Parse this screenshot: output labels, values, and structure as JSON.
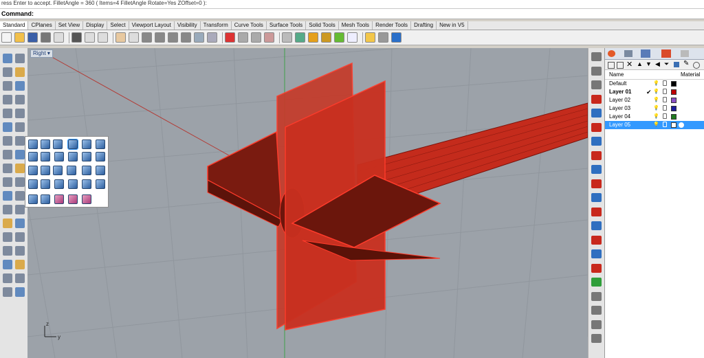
{
  "command": {
    "history": "ress Enter to accept. FilletAngle = 360 ( Items=4  FilletAngle  Rotate=Yes  ZOffset=0 ):",
    "prompt_label": "Command:",
    "value": ""
  },
  "tabs": [
    "Standard",
    "CPlanes",
    "Set View",
    "Display",
    "Select",
    "Viewport Layout",
    "Visibility",
    "Transform",
    "Curve Tools",
    "Surface Tools",
    "Solid Tools",
    "Mesh Tools",
    "Render Tools",
    "Drafting",
    "New in V5"
  ],
  "active_tab": "Standard",
  "viewport": {
    "title": "Right",
    "axis_z": "z",
    "axis_y": "y"
  },
  "layers": {
    "columns": {
      "name": "Name",
      "material": "Material"
    },
    "rows": [
      {
        "name": "Default",
        "color": "#000000",
        "current": false,
        "selected": false
      },
      {
        "name": "Layer 01",
        "color": "#c00000",
        "current": true,
        "selected": false
      },
      {
        "name": "Layer 02",
        "color": "#8a4fc4",
        "current": false,
        "selected": false
      },
      {
        "name": "Layer 03",
        "color": "#1c1c9a",
        "current": false,
        "selected": false
      },
      {
        "name": "Layer 04",
        "color": "#1f7a1f",
        "current": false,
        "selected": false
      },
      {
        "name": "Layer 05",
        "color": "#ffffff",
        "current": false,
        "selected": true
      }
    ]
  },
  "colors": {
    "accent": "#3399ff",
    "object": "#c0261a",
    "viewport_bg": "#9ca2a9"
  }
}
